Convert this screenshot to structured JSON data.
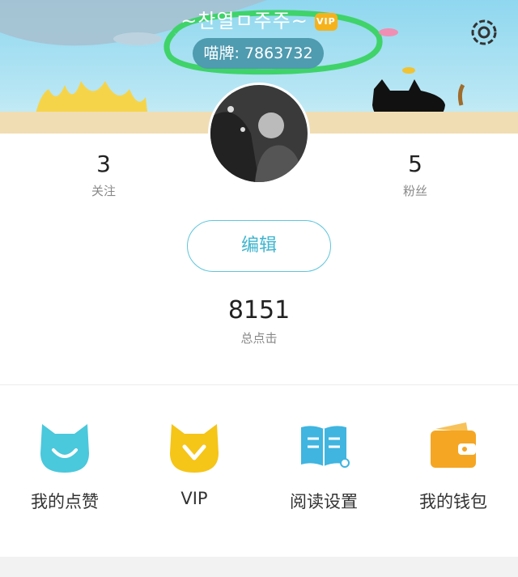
{
  "profile": {
    "username": "~찬열ㅁ주주~",
    "vip_badge": "VIP",
    "id_label": "喵牌: 7863732"
  },
  "stats": {
    "following_count": "3",
    "following_label": "关注",
    "fans_count": "5",
    "fans_label": "粉丝"
  },
  "edit_button": "编辑",
  "clicks": {
    "value": "8151",
    "label": "总点击"
  },
  "menu": [
    {
      "label": "我的点赞",
      "icon": "cat-like-icon"
    },
    {
      "label": "VIP",
      "icon": "vip-cat-icon"
    },
    {
      "label": "阅读设置",
      "icon": "book-icon"
    },
    {
      "label": "我的钱包",
      "icon": "wallet-icon"
    }
  ],
  "colors": {
    "accent": "#3fb5cf",
    "vip_yellow": "#f5c518",
    "wallet_orange": "#f5a623",
    "header_sky": "#8fd7ef"
  }
}
